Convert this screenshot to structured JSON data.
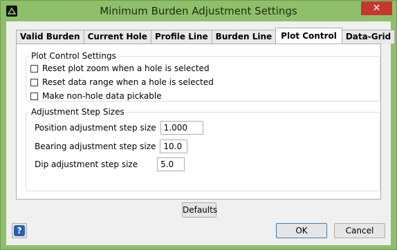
{
  "window": {
    "title": "Minimum Burden Adjustment Settings",
    "close_glyph": "✕",
    "icon": "app-logo-icon"
  },
  "tabs": [
    {
      "label": "Valid Burden",
      "active": false
    },
    {
      "label": "Current Hole",
      "active": false
    },
    {
      "label": "Profile Line",
      "active": false
    },
    {
      "label": "Burden Line",
      "active": false
    },
    {
      "label": "Plot Control",
      "active": true
    },
    {
      "label": "Data-Grid",
      "active": false
    }
  ],
  "plot_control": {
    "title": "Plot Control Settings",
    "options": [
      {
        "label": "Reset plot zoom when a hole is selected",
        "checked": false
      },
      {
        "label": "Reset data range when a hole is selected",
        "checked": false
      },
      {
        "label": "Make non-hole data pickable",
        "checked": false
      }
    ]
  },
  "step_sizes": {
    "title": "Adjustment Step Sizes",
    "fields": [
      {
        "label": "Position adjustment step size",
        "value": "1.000"
      },
      {
        "label": "Bearing adjustment step size",
        "value": "10.0"
      },
      {
        "label": "Dip adjustment step size",
        "value": "5.0"
      }
    ]
  },
  "buttons": {
    "defaults": "Defaults",
    "ok": "OK",
    "cancel": "Cancel",
    "help_glyph": "?"
  }
}
